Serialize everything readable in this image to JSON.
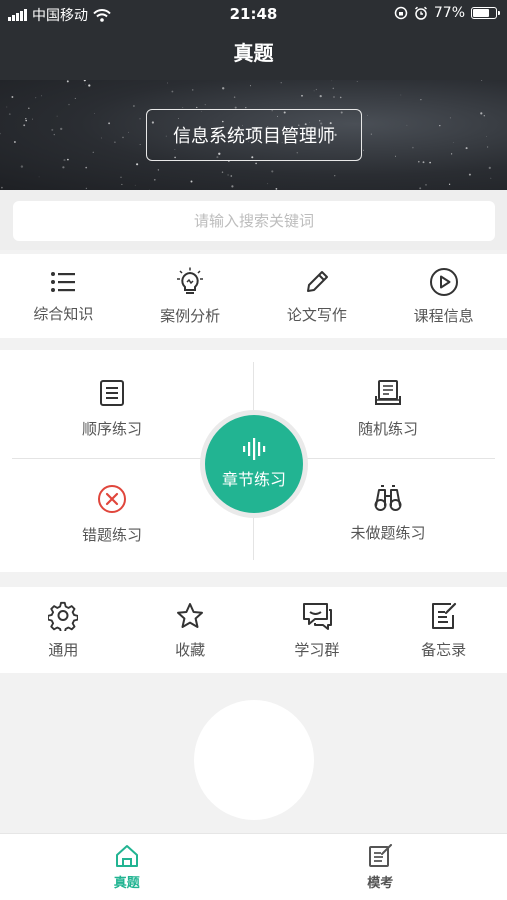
{
  "status_bar": {
    "carrier": "中国移动",
    "time": "21:48",
    "battery_text": "77%",
    "battery_level": 0.77
  },
  "header": {
    "title": "真题"
  },
  "banner": {
    "title": "信息系统项目管理师"
  },
  "search": {
    "placeholder": "请输入搜索关键词"
  },
  "quick_row": [
    {
      "label": "综合知识",
      "icon": "list-icon"
    },
    {
      "label": "案例分析",
      "icon": "lightbulb-icon"
    },
    {
      "label": "论文写作",
      "icon": "pencil-icon"
    },
    {
      "label": "课程信息",
      "icon": "play-circle-icon"
    }
  ],
  "practice": {
    "sequential": "顺序练习",
    "random": "随机练习",
    "chapter": "章节练习",
    "wrong": "错题练习",
    "undone": "未做题练习"
  },
  "tools_row": [
    {
      "label": "通用",
      "icon": "gear-icon"
    },
    {
      "label": "收藏",
      "icon": "star-icon"
    },
    {
      "label": "学习群",
      "icon": "chat-icon"
    },
    {
      "label": "备忘录",
      "icon": "memo-icon"
    }
  ],
  "tab_bar": {
    "tabs": [
      {
        "label": "真题",
        "icon": "home-icon",
        "active": true
      },
      {
        "label": "模考",
        "icon": "exam-icon",
        "active": false
      }
    ]
  },
  "colors": {
    "accent": "#22b492",
    "header_bg": "#2c2f33",
    "wrong_red": "#e0463c"
  }
}
